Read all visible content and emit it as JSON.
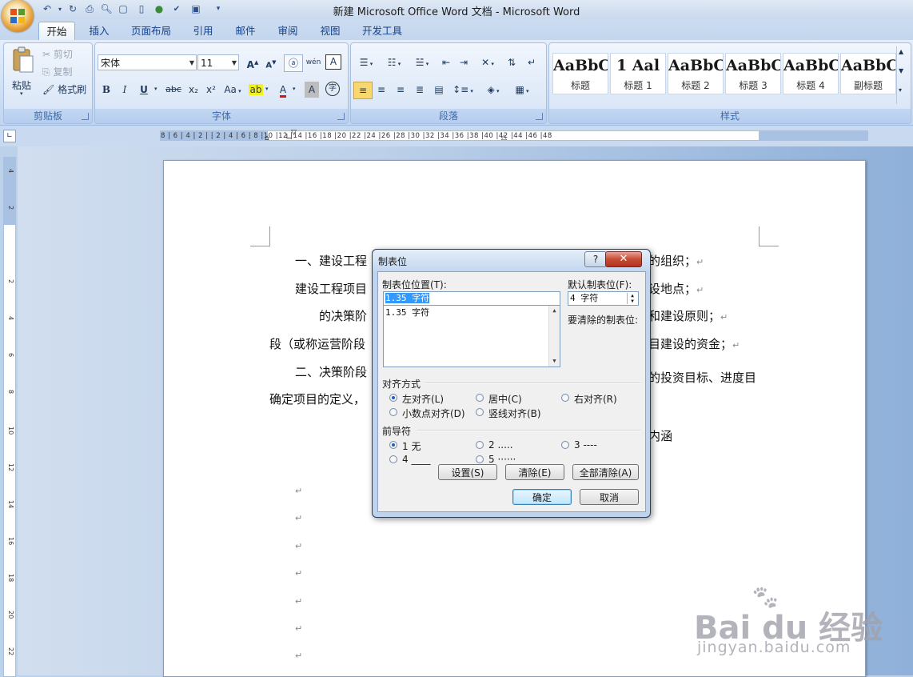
{
  "window": {
    "title": "新建 Microsoft Office Word 文档 - Microsoft Word"
  },
  "qat": [
    "undo-icon",
    "undo-dropdown",
    "redo-icon",
    "print-icon",
    "print-preview-icon",
    "open-icon",
    "new-doc-icon",
    "web-icon",
    "spelling-icon",
    "save-icon",
    "customize-qat-icon"
  ],
  "tabs": [
    "开始",
    "插入",
    "页面布局",
    "引用",
    "邮件",
    "审阅",
    "视图",
    "开发工具"
  ],
  "ribbon": {
    "clipboard": {
      "label": "剪贴板",
      "paste": "粘贴",
      "cut": "剪切",
      "copy": "复制",
      "format_painter": "格式刷"
    },
    "font": {
      "label": "字体",
      "font_name": "宋体",
      "font_size": "11",
      "bold": "B",
      "italic": "I",
      "underline": "U",
      "strike": "abc",
      "subscript": "x₂",
      "superscript": "x²",
      "change_case": "Aa",
      "grow": "A",
      "shrink": "A",
      "phonetic": "wén",
      "char_border": "A",
      "char_shading": "A",
      "enclose": "字"
    },
    "paragraph": {
      "label": "段落"
    },
    "styles": {
      "label": "样式",
      "items": [
        {
          "sample": "AaBbC",
          "name": "标题"
        },
        {
          "sample": "1 Aal",
          "name": "标题 1"
        },
        {
          "sample": "AaBbCc",
          "name": "标题 2"
        },
        {
          "sample": "AaBbC",
          "name": "标题 3"
        },
        {
          "sample": "AaBbC",
          "name": "标题 4"
        },
        {
          "sample": "AaBbC",
          "name": "副标题"
        }
      ]
    }
  },
  "ruler": {
    "numbers": "8 | 6 | 4 | 2 |  | 2 | 4 | 6 | 8 |10 |12 |14 |16 |18 |20 |22 |24 |26 |28 |30 |32 |34 |36 |38 |40 |42 |44 |46 |48",
    "vertical": [
      "4",
      "2",
      "",
      "2",
      "4",
      "6",
      "8",
      "10",
      "12",
      "14",
      "16",
      "18",
      "20",
      "22"
    ]
  },
  "document": {
    "lines": [
      {
        "left": "一、建设工程",
        "right": "的组织；"
      },
      {
        "left": "建设工程项目",
        "right": "设地点；"
      },
      {
        "left": "的决策阶",
        "right": "和建设原则；"
      },
      {
        "left": "段（或称运营阶段",
        "right": "目建设的资金；"
      },
      {
        "left": "二、决策阶段",
        "right": "的投资目标、进度目"
      },
      {
        "left": "确定项目的定义，",
        "right": ""
      },
      {
        "left": "",
        "right": "内涵"
      }
    ],
    "para_mark": "↵"
  },
  "dialog": {
    "title": "制表位",
    "help": "?",
    "close": "✕",
    "tab_position_label": "制表位位置(T):",
    "tab_position_value": "1.35 字符",
    "tab_list": [
      "1.35 字符"
    ],
    "default_tab_label": "默认制表位(F):",
    "default_tab_value": "4 字符",
    "clear_label": "要清除的制表位:",
    "alignment_label": "对齐方式",
    "alignment_options": [
      "左对齐(L)",
      "居中(C)",
      "右对齐(R)",
      "小数点对齐(D)",
      "竖线对齐(B)"
    ],
    "alignment_selected": "左对齐(L)",
    "leader_label": "前导符",
    "leader_options": [
      "1 无",
      "2 .....",
      "3 ----",
      "4 ____",
      "5 ······"
    ],
    "leader_selected": "1 无",
    "buttons": {
      "set": "设置(S)",
      "clear": "清除(E)",
      "clear_all": "全部清除(A)",
      "ok": "确定",
      "cancel": "取消"
    }
  },
  "watermark": {
    "brand": "Bai du 经验",
    "url": "jingyan.baidu.com"
  }
}
